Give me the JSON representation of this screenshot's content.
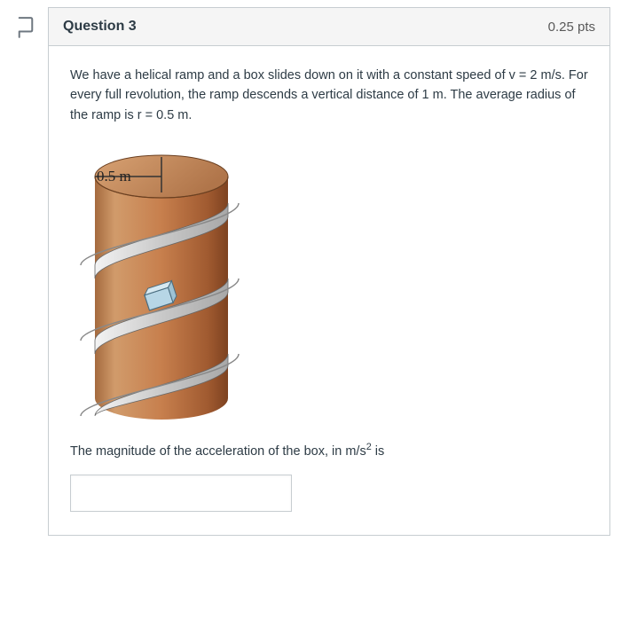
{
  "question": {
    "title": "Question 3",
    "points": "0.25 pts",
    "text": "We have a helical ramp and a box slides down on it with a constant speed of v = 2 m/s. For every full revolution, the ramp descends a vertical distance of 1 m. The average radius of the ramp is r = 0.5 m.",
    "radius_label": "0.5 m",
    "prompt_pre": "The magnitude of the acceleration of the box, in m/s",
    "prompt_exp": "2",
    "prompt_post": " is",
    "answer_value": ""
  },
  "icons": {
    "flag": "flag-icon"
  }
}
